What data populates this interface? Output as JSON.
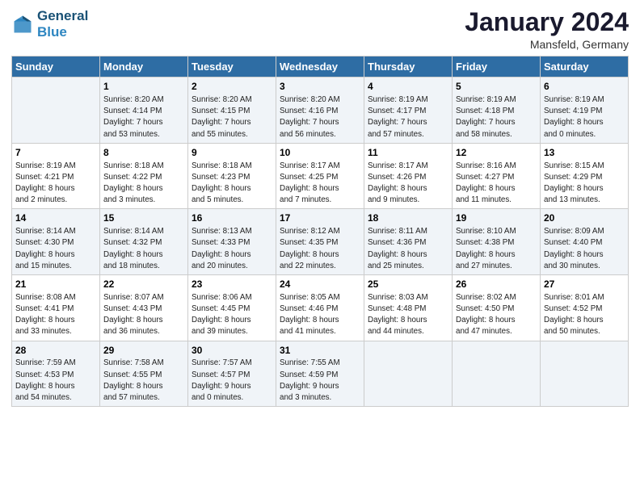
{
  "logo": {
    "line1": "General",
    "line2": "Blue"
  },
  "title": "January 2024",
  "location": "Mansfeld, Germany",
  "days_header": [
    "Sunday",
    "Monday",
    "Tuesday",
    "Wednesday",
    "Thursday",
    "Friday",
    "Saturday"
  ],
  "weeks": [
    [
      {
        "day": "",
        "info": ""
      },
      {
        "day": "1",
        "info": "Sunrise: 8:20 AM\nSunset: 4:14 PM\nDaylight: 7 hours\nand 53 minutes."
      },
      {
        "day": "2",
        "info": "Sunrise: 8:20 AM\nSunset: 4:15 PM\nDaylight: 7 hours\nand 55 minutes."
      },
      {
        "day": "3",
        "info": "Sunrise: 8:20 AM\nSunset: 4:16 PM\nDaylight: 7 hours\nand 56 minutes."
      },
      {
        "day": "4",
        "info": "Sunrise: 8:19 AM\nSunset: 4:17 PM\nDaylight: 7 hours\nand 57 minutes."
      },
      {
        "day": "5",
        "info": "Sunrise: 8:19 AM\nSunset: 4:18 PM\nDaylight: 7 hours\nand 58 minutes."
      },
      {
        "day": "6",
        "info": "Sunrise: 8:19 AM\nSunset: 4:19 PM\nDaylight: 8 hours\nand 0 minutes."
      }
    ],
    [
      {
        "day": "7",
        "info": "Sunrise: 8:19 AM\nSunset: 4:21 PM\nDaylight: 8 hours\nand 2 minutes."
      },
      {
        "day": "8",
        "info": "Sunrise: 8:18 AM\nSunset: 4:22 PM\nDaylight: 8 hours\nand 3 minutes."
      },
      {
        "day": "9",
        "info": "Sunrise: 8:18 AM\nSunset: 4:23 PM\nDaylight: 8 hours\nand 5 minutes."
      },
      {
        "day": "10",
        "info": "Sunrise: 8:17 AM\nSunset: 4:25 PM\nDaylight: 8 hours\nand 7 minutes."
      },
      {
        "day": "11",
        "info": "Sunrise: 8:17 AM\nSunset: 4:26 PM\nDaylight: 8 hours\nand 9 minutes."
      },
      {
        "day": "12",
        "info": "Sunrise: 8:16 AM\nSunset: 4:27 PM\nDaylight: 8 hours\nand 11 minutes."
      },
      {
        "day": "13",
        "info": "Sunrise: 8:15 AM\nSunset: 4:29 PM\nDaylight: 8 hours\nand 13 minutes."
      }
    ],
    [
      {
        "day": "14",
        "info": "Sunrise: 8:14 AM\nSunset: 4:30 PM\nDaylight: 8 hours\nand 15 minutes."
      },
      {
        "day": "15",
        "info": "Sunrise: 8:14 AM\nSunset: 4:32 PM\nDaylight: 8 hours\nand 18 minutes."
      },
      {
        "day": "16",
        "info": "Sunrise: 8:13 AM\nSunset: 4:33 PM\nDaylight: 8 hours\nand 20 minutes."
      },
      {
        "day": "17",
        "info": "Sunrise: 8:12 AM\nSunset: 4:35 PM\nDaylight: 8 hours\nand 22 minutes."
      },
      {
        "day": "18",
        "info": "Sunrise: 8:11 AM\nSunset: 4:36 PM\nDaylight: 8 hours\nand 25 minutes."
      },
      {
        "day": "19",
        "info": "Sunrise: 8:10 AM\nSunset: 4:38 PM\nDaylight: 8 hours\nand 27 minutes."
      },
      {
        "day": "20",
        "info": "Sunrise: 8:09 AM\nSunset: 4:40 PM\nDaylight: 8 hours\nand 30 minutes."
      }
    ],
    [
      {
        "day": "21",
        "info": "Sunrise: 8:08 AM\nSunset: 4:41 PM\nDaylight: 8 hours\nand 33 minutes."
      },
      {
        "day": "22",
        "info": "Sunrise: 8:07 AM\nSunset: 4:43 PM\nDaylight: 8 hours\nand 36 minutes."
      },
      {
        "day": "23",
        "info": "Sunrise: 8:06 AM\nSunset: 4:45 PM\nDaylight: 8 hours\nand 39 minutes."
      },
      {
        "day": "24",
        "info": "Sunrise: 8:05 AM\nSunset: 4:46 PM\nDaylight: 8 hours\nand 41 minutes."
      },
      {
        "day": "25",
        "info": "Sunrise: 8:03 AM\nSunset: 4:48 PM\nDaylight: 8 hours\nand 44 minutes."
      },
      {
        "day": "26",
        "info": "Sunrise: 8:02 AM\nSunset: 4:50 PM\nDaylight: 8 hours\nand 47 minutes."
      },
      {
        "day": "27",
        "info": "Sunrise: 8:01 AM\nSunset: 4:52 PM\nDaylight: 8 hours\nand 50 minutes."
      }
    ],
    [
      {
        "day": "28",
        "info": "Sunrise: 7:59 AM\nSunset: 4:53 PM\nDaylight: 8 hours\nand 54 minutes."
      },
      {
        "day": "29",
        "info": "Sunrise: 7:58 AM\nSunset: 4:55 PM\nDaylight: 8 hours\nand 57 minutes."
      },
      {
        "day": "30",
        "info": "Sunrise: 7:57 AM\nSunset: 4:57 PM\nDaylight: 9 hours\nand 0 minutes."
      },
      {
        "day": "31",
        "info": "Sunrise: 7:55 AM\nSunset: 4:59 PM\nDaylight: 9 hours\nand 3 minutes."
      },
      {
        "day": "",
        "info": ""
      },
      {
        "day": "",
        "info": ""
      },
      {
        "day": "",
        "info": ""
      }
    ]
  ]
}
